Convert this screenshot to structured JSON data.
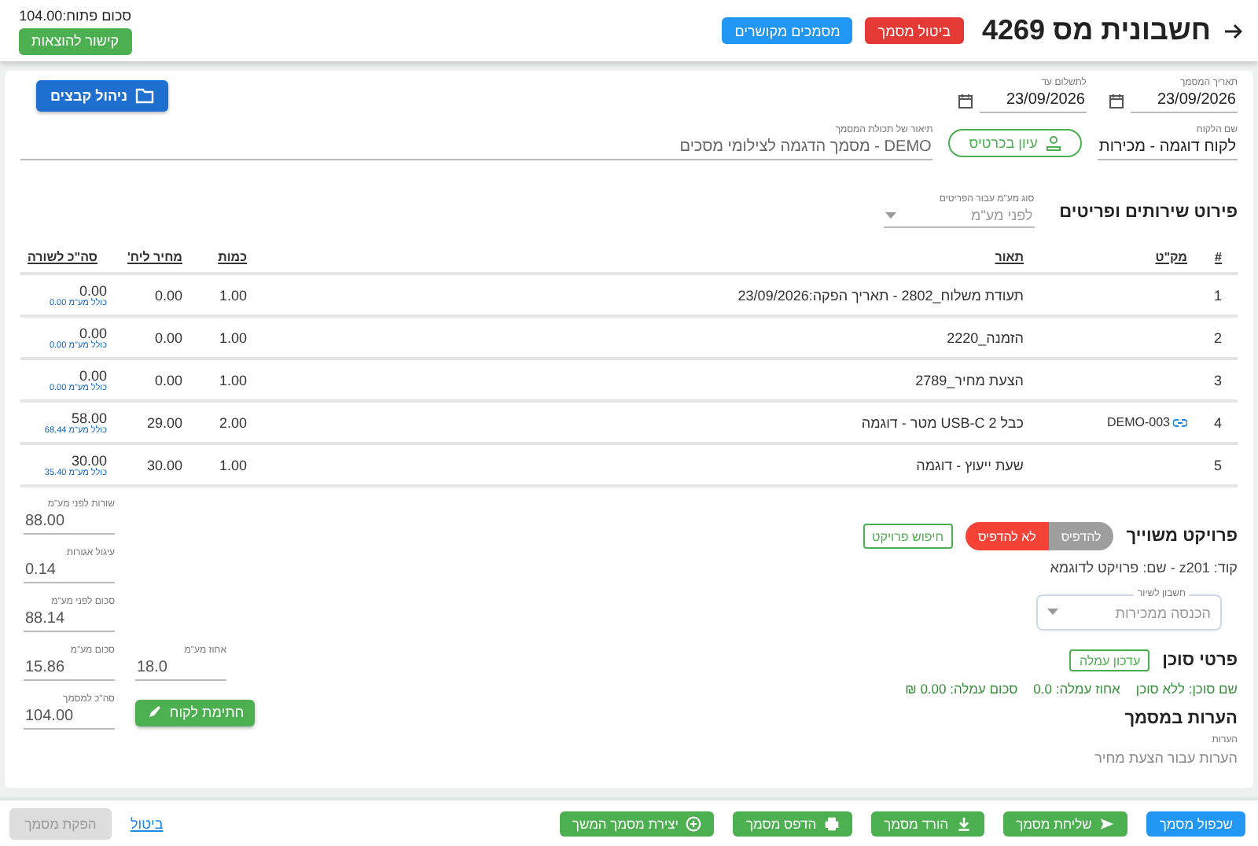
{
  "header": {
    "title": "חשבונית מס 4269",
    "buttons": [
      {
        "label": "ביטול מסמך",
        "kind": "danger"
      },
      {
        "label": "מסמכים מקושרים",
        "kind": "primary"
      }
    ],
    "open_balance": "סכום פתוח:104.00",
    "expenses_button": "קישור להוצאות"
  },
  "document": {
    "date_fields": [
      {
        "label": "תאריך המסמך",
        "value": "23/09/2026"
      },
      {
        "label": "לתשלום עד",
        "value": "23/09/2026"
      }
    ],
    "files_button": "ניהול קבצים",
    "customer": {
      "label": "שם הלקוח",
      "value": "לקוח דוגמה - מכירות"
    },
    "customer_card_button": "עיון בכרטיס",
    "description": {
      "label": "תיאור של תכולת המסמך",
      "value": "DEMO - מסמך הדגמה לצילומי מסכים"
    }
  },
  "items": {
    "title": "פירוט שירותים ופריטים",
    "vat_type": {
      "label": "סוג מע\"מ עבור הפריטים",
      "placeholder": "לפני מע\"מ"
    },
    "columns": [
      "#",
      "מק\"ט",
      "תאור",
      "כמות",
      "מחיר ליח'",
      "סה\"כ לשורה"
    ],
    "rows": [
      {
        "num": "1",
        "description": "תעודת משלוח_2802 - תאריך הפקה:23/09/2026",
        "qty": "1.00",
        "unit_price": "0.00",
        "total": "0.00",
        "total_with_vat": "כולל מע\"מ 0.00"
      },
      {
        "num": "2",
        "description": "הזמנה_2220",
        "qty": "1.00",
        "unit_price": "0.00",
        "total": "0.00",
        "total_with_vat": "כולל מע\"מ 0.00"
      },
      {
        "num": "3",
        "description": "הצעת מחיר_2789",
        "qty": "1.00",
        "unit_price": "0.00",
        "total": "0.00",
        "total_with_vat": "כולל מע\"מ 0.00"
      },
      {
        "num": "4",
        "sku": "DEMO-003",
        "description": "כבל USB-C 2 מטר - דוגמה",
        "qty": "2.00",
        "unit_price": "29.00",
        "total": "58.00",
        "total_with_vat": "כולל מע\"מ 68.44"
      },
      {
        "num": "5",
        "description": "שעת ייעוץ - דוגמה",
        "qty": "1.00",
        "unit_price": "30.00",
        "total": "30.00",
        "total_with_vat": "כולל מע\"מ 35.40"
      }
    ]
  },
  "project": {
    "title": "פרויקט משוייך",
    "print_toggle": [
      {
        "label": "להדפיס",
        "selected": false
      },
      {
        "label": "לא להדפיס",
        "selected": true
      }
    ],
    "search_button": "חיפוש פרויקט",
    "info": "קוד: z201 - שם: פרויקט לדוגמא",
    "account": {
      "label": "חשבון לשיור",
      "placeholder": "הכנסה ממכירות"
    }
  },
  "agent": {
    "title": "פרטי סוכן",
    "update_button": "עדכון עמלה",
    "details": [
      "שם סוכן: ללא סוכן",
      "אחוז עמלה: 0.0",
      "סכום עמלה: 0.00 ₪"
    ]
  },
  "notes": {
    "title": "הערות במסמך",
    "label": "הערות",
    "placeholder": "הערות עבור הצעת מחיר"
  },
  "totals": [
    {
      "label": "שורות לפני מע\"מ",
      "value": "88.00"
    },
    {
      "label": "עיגול אגורות",
      "value": "0.14"
    },
    {
      "label": "סכום לפני מע\"מ",
      "value": "88.14"
    },
    {
      "label": "סכום מע\"מ",
      "value": "15.86"
    },
    {
      "label": "סה\"כ למסמך",
      "value": "104.00"
    }
  ],
  "vat_percent": {
    "label": "אחוז מע\"מ",
    "value": "18.0"
  },
  "sign_button": "חתימת לקוח",
  "footer": {
    "actions": [
      {
        "label": "שכפול מסמך",
        "kind": "primary"
      },
      {
        "label": "שליחת מסמך",
        "kind": "success"
      },
      {
        "label": "הורד מסמך",
        "kind": "success"
      },
      {
        "label": "הדפס מסמך",
        "kind": "success"
      },
      {
        "label": "יצירת מסמך המשך",
        "kind": "success"
      }
    ],
    "cancel_link": "ביטול",
    "issue_button": {
      "label": "הפקת מסמך",
      "disabled": true
    }
  }
}
